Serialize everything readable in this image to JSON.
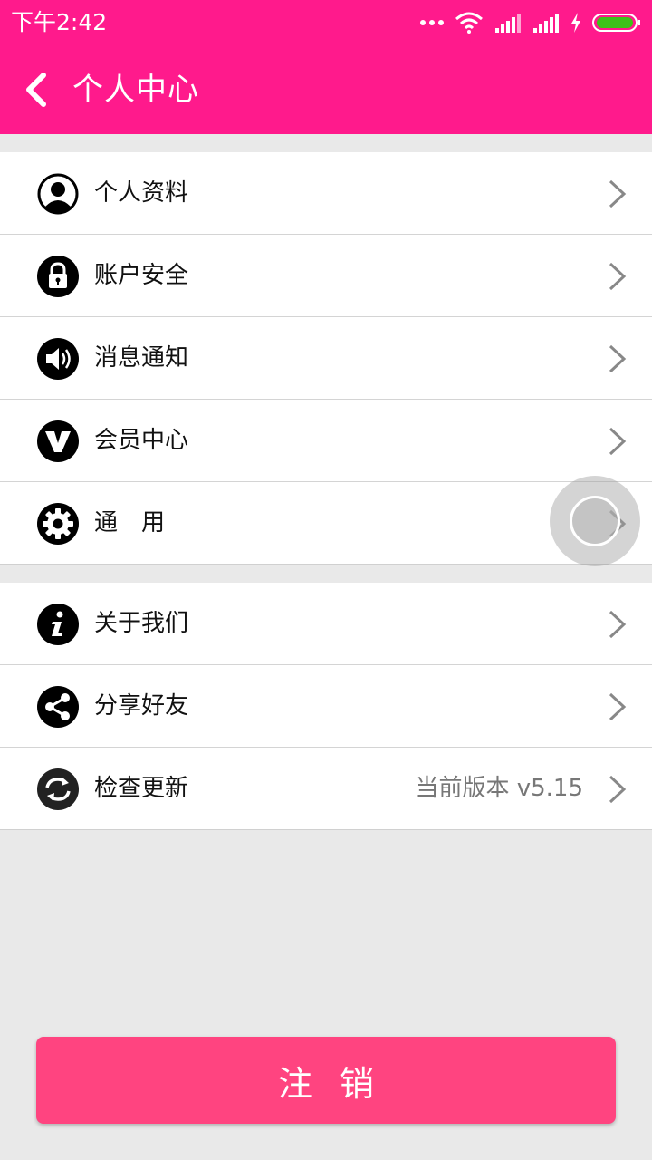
{
  "status": {
    "time": "下午2:42"
  },
  "header": {
    "title": "个人中心"
  },
  "menu1": [
    {
      "label": "个人资料",
      "icon": "user-circle-icon"
    },
    {
      "label": "账户安全",
      "icon": "lock-icon"
    },
    {
      "label": "消息通知",
      "icon": "speaker-icon"
    },
    {
      "label": "会员中心",
      "icon": "vip-v-icon"
    },
    {
      "label": "通　用",
      "icon": "gear-icon"
    }
  ],
  "menu2": [
    {
      "label": "关于我们",
      "icon": "info-icon"
    },
    {
      "label": "分享好友",
      "icon": "share-icon"
    },
    {
      "label": "检查更新",
      "icon": "refresh-icon",
      "value": "当前版本 v5.15"
    }
  ],
  "logout": {
    "label": "注销"
  },
  "colors": {
    "header": "#ff1a8c",
    "logout": "#ff4480",
    "background": "#e9e9e9"
  }
}
